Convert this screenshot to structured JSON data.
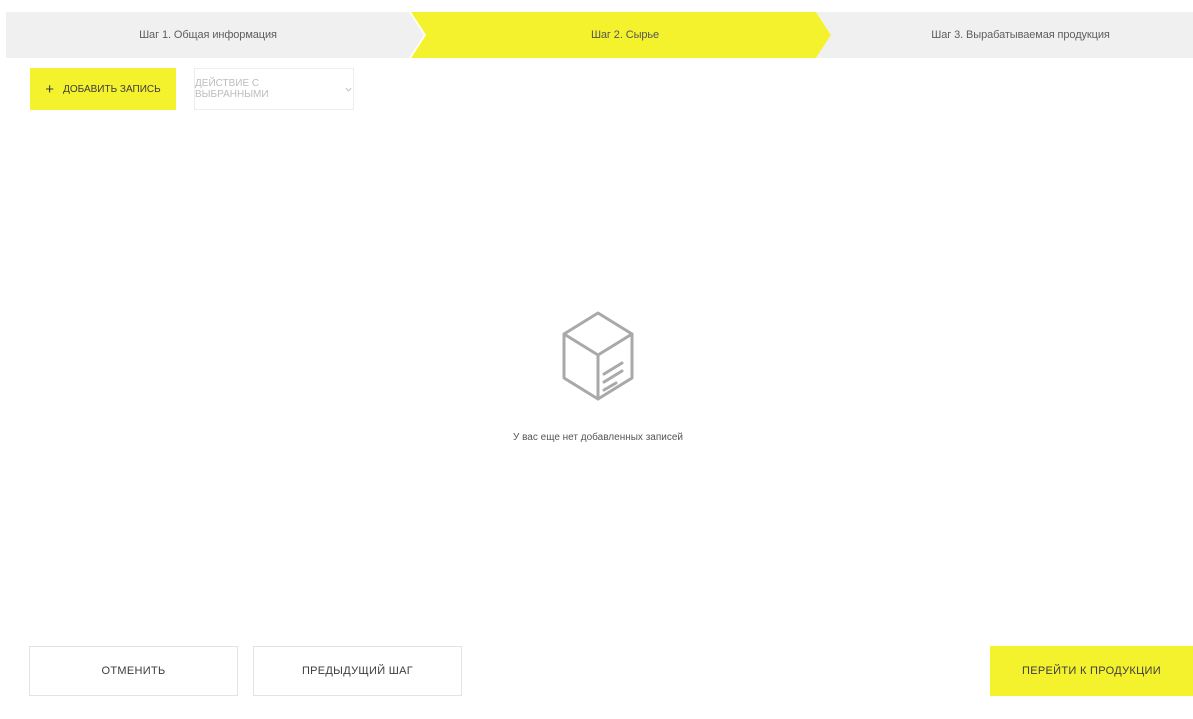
{
  "stepper": {
    "steps": [
      {
        "label": "Шаг 1. Общая информация",
        "state": "done"
      },
      {
        "label": "Шаг 2. Сырье",
        "state": "active"
      },
      {
        "label": "Шаг 3. Вырабатываемая продукция",
        "state": "pending"
      }
    ],
    "active_color": "#f4f22d",
    "inactive_color": "#f0f0f0"
  },
  "toolbar": {
    "add_button": {
      "icon": "plus-icon",
      "label": "ДОБАВИТЬ ЗАПИСЬ"
    },
    "bulk_action": {
      "label": "ДЕЙСТВИЕ С ВЫБРАННЫМИ",
      "icon": "chevron-down-icon"
    }
  },
  "empty_state": {
    "icon": "box-icon",
    "message": "У вас еще нет добавленных записей"
  },
  "footer": {
    "cancel_label": "ОТМЕНИТЬ",
    "previous_label": "ПРЕДЫДУЩИЙ ШАГ",
    "next_label": "ПЕРЕЙТИ К ПРОДУКЦИИ"
  },
  "colors": {
    "accent": "#f4f22d",
    "muted_text": "#bdbdbd",
    "border": "#e3e3e3"
  }
}
